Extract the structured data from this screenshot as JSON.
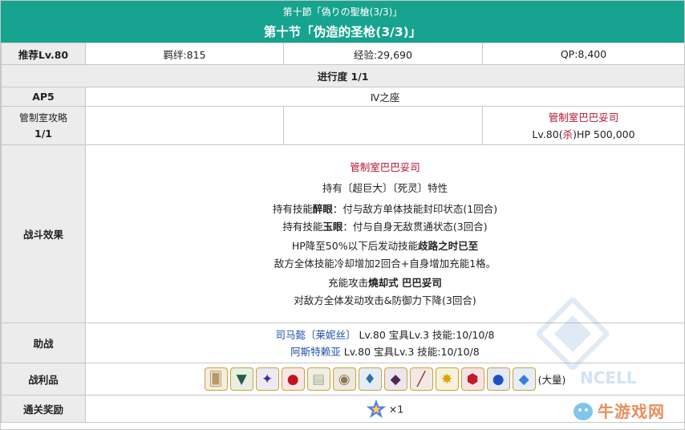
{
  "header": {
    "title_jp": "第十節「偽りの聖槍(3/3)」",
    "title_cn": "第十节「伪造的圣枪(3/3)」"
  },
  "info": {
    "rec_level": "推荐Lv.80",
    "bond": "羁绊:815",
    "exp": "经验:29,690",
    "qp": "QP:8,400"
  },
  "progress": "进行度 1/1",
  "ap": {
    "label": "AP5",
    "location": "Ⅳ之座"
  },
  "enemy": {
    "label_line1": "管制室攻略",
    "label_line2": "1/1",
    "name": "管制室巴巴妥司",
    "level": "Lv.80(",
    "class": "杀",
    "hp": ")HP 500,000"
  },
  "battle": {
    "label": "战斗效果",
    "boss_name": "管制室巴巴妥司",
    "line_trait": "持有〔超巨大〕〔死灵〕特性",
    "skill1_pre": "持有技能",
    "skill1_name": "醉眼",
    "skill1_post": "：付与敌方单体技能封印状态(1回合)",
    "skill2_pre": "持有技能",
    "skill2_name": "玉眼",
    "skill2_post": "：付与自身无敌贯通状态(3回合)",
    "hp_pre": "HP降至50%以下后发动技能",
    "hp_skill": "歧路之时已至",
    "hp_effect": "敌方全体技能冷却增加2回合+自身增加充能1格。",
    "np_pre": "充能攻击",
    "np_name": "燒却式 巴巴妥司",
    "np_effect": "对敌方全体发动攻击&防御力下降(3回合)"
  },
  "support": {
    "label": "助战",
    "s1_name": "司马懿〔莱妮丝〕",
    "s1_detail": " Lv.80 宝具Lv.3 技能:10/10/8",
    "s2_name": "阿斯特赖亚",
    "s2_detail": " Lv.80 宝具Lv.3 技能:10/10/8"
  },
  "drops": {
    "label": "战利品",
    "suffix": "(大量)",
    "items": [
      {
        "icon": "craft-essence-icon",
        "bg": "#f4eee0",
        "glyph": "🂠",
        "color": "#b89a6a"
      },
      {
        "icon": "dragon-wing-icon",
        "bg": "#e9efe3",
        "glyph": "▼",
        "color": "#2a5a4a"
      },
      {
        "icon": "black-fang-icon",
        "bg": "#ecebf3",
        "glyph": "✦",
        "color": "#3b2fa0"
      },
      {
        "icon": "blood-drop-icon",
        "bg": "#f7e6e6",
        "glyph": "●",
        "color": "#c0141f"
      },
      {
        "icon": "map-scroll-icon",
        "bg": "#f1efe4",
        "glyph": "▤",
        "color": "#9fb08c"
      },
      {
        "icon": "shell-icon",
        "bg": "#ede9e1",
        "glyph": "◉",
        "color": "#8c7a52"
      },
      {
        "icon": "lantern-icon",
        "bg": "#e5edf4",
        "glyph": "♦",
        "color": "#2a6fb0"
      },
      {
        "icon": "dark-crystal-icon",
        "bg": "#ebe6ee",
        "glyph": "◆",
        "color": "#4a2b4f"
      },
      {
        "icon": "bone-icon",
        "bg": "#f3e9e4",
        "glyph": "╱",
        "color": "#8a2a20"
      },
      {
        "icon": "gold-sparkle-icon",
        "bg": "#f7f1da",
        "glyph": "✸",
        "color": "#e0a400"
      },
      {
        "icon": "red-gem-icon",
        "bg": "#f6e4e4",
        "glyph": "⬢",
        "color": "#c21a2a"
      },
      {
        "icon": "blue-orb-icon",
        "bg": "#e3eaf6",
        "glyph": "●",
        "color": "#1d4fc4"
      },
      {
        "icon": "blue-crystal-icon",
        "bg": "#e6eef7",
        "glyph": "◆",
        "color": "#3a7fd4"
      }
    ]
  },
  "reward": {
    "label": "通关奖励",
    "icon": "saint-quartz-icon",
    "count": "×1"
  },
  "colors": {
    "header": "#16a38f",
    "accent_red": "#b5122f",
    "link_blue": "#1f4ea8"
  }
}
